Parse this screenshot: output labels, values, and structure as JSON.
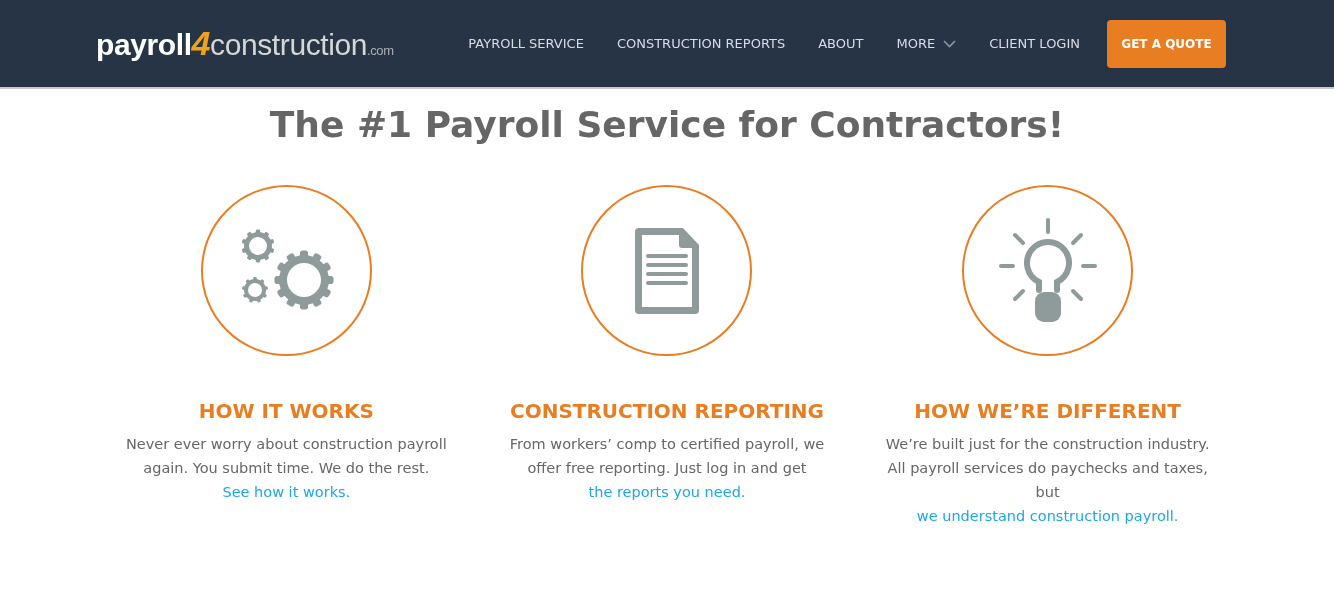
{
  "header": {
    "logo": {
      "part_1": "payroll",
      "part_2": "4",
      "part_3": "construction",
      "part_4": ".com"
    },
    "nav": [
      {
        "label": "PAYROLL SERVICE",
        "dropdown": false
      },
      {
        "label": "CONSTRUCTION REPORTS",
        "dropdown": false
      },
      {
        "label": "ABOUT",
        "dropdown": false
      },
      {
        "label": "MORE",
        "dropdown": true
      },
      {
        "label": "CLIENT LOGIN",
        "dropdown": false
      }
    ],
    "cta": "GET A QUOTE"
  },
  "headline": "The #1 Payroll Service for Contractors!",
  "features": [
    {
      "title": "HOW IT WORKS",
      "text": "Never ever worry about construction payroll again. You submit time. We do the rest.",
      "link": "See how it works."
    },
    {
      "title": "CONSTRUCTION REPORTING",
      "text": "From workers’ comp to certified payroll, we offer free reporting. Just log in and get",
      "link": "the reports you need."
    },
    {
      "title": "HOW WE’RE DIFFERENT",
      "text": "We’re built just for the construction industry. All payroll services do paychecks and taxes, but",
      "link": "we understand construction payroll."
    }
  ]
}
